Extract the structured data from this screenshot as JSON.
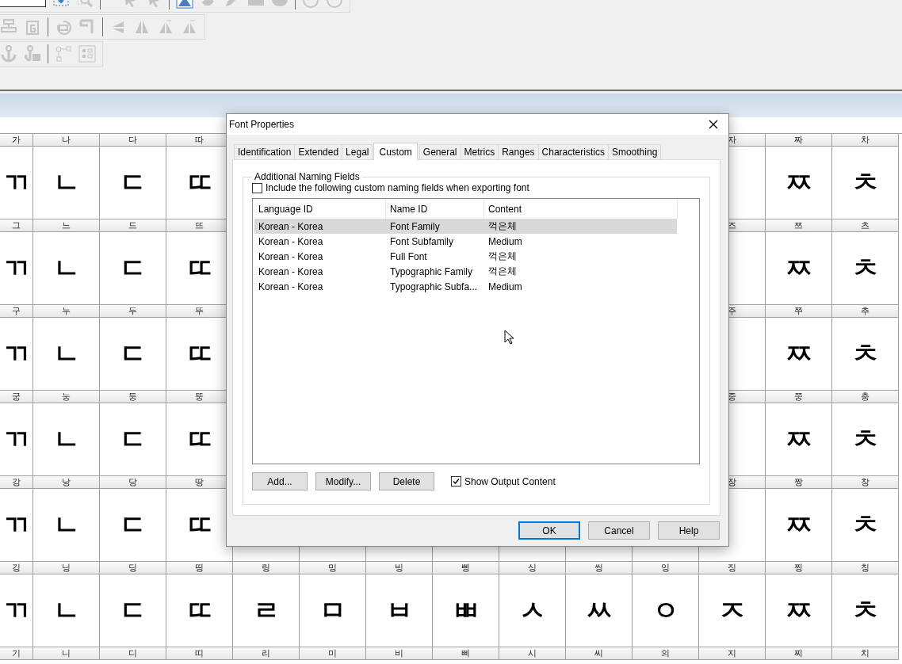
{
  "glyph_grid": {
    "rows": [
      {
        "cells": [
          {
            "label": "가",
            "glyph": "ㄲ"
          },
          {
            "label": "나",
            "glyph": "ㄴ"
          },
          {
            "label": "다",
            "glyph": "ㄷ"
          },
          {
            "label": "따",
            "glyph": "ㄸ"
          },
          {},
          {},
          {},
          {},
          {},
          {},
          {},
          {
            "label": "자"
          },
          {
            "label": "짜",
            "glyph": "ㅉ"
          },
          {
            "label": "차",
            "glyph": "ㅊ"
          }
        ]
      },
      {
        "cells": [
          {
            "label": "그",
            "glyph": "ㄲ"
          },
          {
            "label": "느",
            "glyph": "ㄴ"
          },
          {
            "label": "드",
            "glyph": "ㄷ"
          },
          {
            "label": "뜨",
            "glyph": "ㄸ"
          },
          {},
          {},
          {},
          {},
          {},
          {},
          {},
          {
            "label": "즈"
          },
          {
            "label": "쯔",
            "glyph": "ㅉ"
          },
          {
            "label": "츠",
            "glyph": "ㅊ"
          }
        ]
      },
      {
        "cells": [
          {
            "label": "구",
            "glyph": "ㄲ"
          },
          {
            "label": "누",
            "glyph": "ㄴ"
          },
          {
            "label": "두",
            "glyph": "ㄷ"
          },
          {
            "label": "뚜",
            "glyph": "ㄸ"
          },
          {},
          {},
          {},
          {},
          {},
          {},
          {},
          {
            "label": "주"
          },
          {
            "label": "쭈",
            "glyph": "ㅉ"
          },
          {
            "label": "추",
            "glyph": "ㅊ"
          }
        ]
      },
      {
        "cells": [
          {
            "label": "궁",
            "glyph": "ㄲ"
          },
          {
            "label": "눙",
            "glyph": "ㄴ"
          },
          {
            "label": "둥",
            "glyph": "ㄷ"
          },
          {
            "label": "뚱",
            "glyph": "ㄸ"
          },
          {},
          {},
          {},
          {},
          {},
          {},
          {},
          {
            "label": "중"
          },
          {
            "label": "쭝",
            "glyph": "ㅉ"
          },
          {
            "label": "충",
            "glyph": "ㅊ"
          }
        ]
      },
      {
        "cells": [
          {
            "label": "강",
            "glyph": "ㄲ"
          },
          {
            "label": "낭",
            "glyph": "ㄴ"
          },
          {
            "label": "당",
            "glyph": "ㄷ"
          },
          {
            "label": "땅",
            "glyph": "ㄸ"
          },
          {},
          {},
          {},
          {},
          {},
          {},
          {},
          {
            "label": "장"
          },
          {
            "label": "짱",
            "glyph": "ㅉ"
          },
          {
            "label": "창",
            "glyph": "ㅊ"
          }
        ]
      },
      {
        "cells": [
          {
            "label": "깅",
            "glyph": "ㄲ"
          },
          {
            "label": "닝",
            "glyph": "ㄴ"
          },
          {
            "label": "딩",
            "glyph": "ㄷ"
          },
          {
            "label": "띵",
            "glyph": "ㄸ"
          },
          {
            "label": "링",
            "glyph": "ㄹ"
          },
          {
            "label": "밍",
            "glyph": "ㅁ"
          },
          {
            "label": "빙",
            "glyph": "ㅂ"
          },
          {
            "label": "삥",
            "glyph": "ㅃ"
          },
          {
            "label": "싱",
            "glyph": "ㅅ"
          },
          {
            "label": "씽",
            "glyph": "ㅆ"
          },
          {
            "label": "잉",
            "glyph": "ㅇ"
          },
          {
            "label": "징",
            "glyph": "ㅈ"
          },
          {
            "label": "찡",
            "glyph": "ㅉ"
          },
          {
            "label": "칭",
            "glyph": "ㅊ"
          }
        ]
      },
      {
        "cells": [
          {
            "label": "기"
          },
          {
            "label": "니"
          },
          {
            "label": "디"
          },
          {
            "label": "띠"
          },
          {
            "label": "리"
          },
          {
            "label": "미"
          },
          {
            "label": "비"
          },
          {
            "label": "삐"
          },
          {
            "label": "시"
          },
          {
            "label": "씨"
          },
          {
            "label": "의"
          },
          {
            "label": "지"
          },
          {
            "label": "찌"
          },
          {
            "label": "치"
          }
        ]
      }
    ]
  },
  "dialog": {
    "title": "Font Properties",
    "tabs": [
      {
        "label": "Identification",
        "selected": false
      },
      {
        "label": "Extended",
        "selected": false
      },
      {
        "label": "Legal",
        "selected": false
      },
      {
        "label": "Custom",
        "selected": true
      },
      {
        "label": "General",
        "selected": false
      },
      {
        "label": "Metrics",
        "selected": false
      },
      {
        "label": "Ranges",
        "selected": false
      },
      {
        "label": "Characteristics",
        "selected": false
      },
      {
        "label": "Smoothing",
        "selected": false
      }
    ],
    "group_title": "Additional Naming Fields",
    "include_checkbox": {
      "label": "Include the following custom naming fields when exporting font",
      "checked": false
    },
    "table": {
      "columns": [
        "Language ID",
        "Name ID",
        "Content"
      ],
      "rows": [
        {
          "cells": [
            "Korean - Korea",
            "Font Family",
            "꺽은체"
          ],
          "selected": true
        },
        {
          "cells": [
            "Korean - Korea",
            "Font Subfamily",
            "Medium"
          ],
          "selected": false
        },
        {
          "cells": [
            "Korean - Korea",
            "Full Font",
            "꺽은체"
          ],
          "selected": false
        },
        {
          "cells": [
            "Korean - Korea",
            "Typographic Family",
            "꺽은체"
          ],
          "selected": false
        },
        {
          "cells": [
            "Korean - Korea",
            "Typographic Subfa...",
            "Medium"
          ],
          "selected": false
        }
      ]
    },
    "list_buttons": [
      "Add...",
      "Modify...",
      "Delete"
    ],
    "output_checkbox": {
      "label": "Show Output Content",
      "checked": true
    },
    "buttons": [
      {
        "label": "OK",
        "default": true
      },
      {
        "label": "Cancel",
        "default": false
      },
      {
        "label": "Help",
        "default": false
      }
    ]
  }
}
